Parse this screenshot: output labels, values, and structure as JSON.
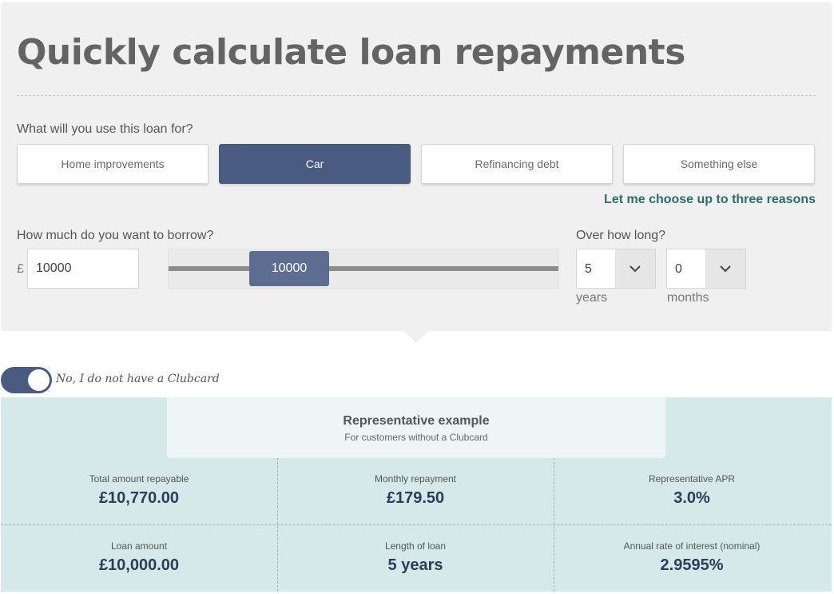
{
  "title": "Quickly calculate loan repayments",
  "purpose": {
    "question": "What will you use this loan for?",
    "options": [
      "Home improvements",
      "Car",
      "Refinancing debt",
      "Something else"
    ],
    "selected": "Car",
    "choose_multiple_link": "Let me choose up to three reasons"
  },
  "borrow": {
    "question": "How much do you want to borrow?",
    "currency_symbol": "£",
    "amount": "10000",
    "slider_value": "10000",
    "slider_position_fraction": 0.21
  },
  "term": {
    "question": "Over how long?",
    "years_value": "5",
    "years_label": "years",
    "months_value": "0",
    "months_label": "months"
  },
  "clubcard": {
    "toggle_label": "No, I do not have a Clubcard",
    "enabled": true
  },
  "representative": {
    "title": "Representative example",
    "subtitle": "For customers without a Clubcard"
  },
  "stats": {
    "total": {
      "label": "Total amount repayable",
      "value": "£10,770.00"
    },
    "monthly": {
      "label": "Monthly repayment",
      "value": "£179.50"
    },
    "apr": {
      "label": "Representative APR",
      "value": "3.0%"
    },
    "loan": {
      "label": "Loan amount",
      "value": "£10,000.00"
    },
    "length": {
      "label": "Length of loan",
      "value": "5 years"
    },
    "rate": {
      "label": "Annual rate of interest (nominal)",
      "value": "2.9595%"
    }
  },
  "colors": {
    "accent": "#4a5b82",
    "link": "#2a6f6a",
    "results_bg": "#d5e9e8"
  },
  "icons": {
    "dropdown": "chevron-down-icon"
  }
}
